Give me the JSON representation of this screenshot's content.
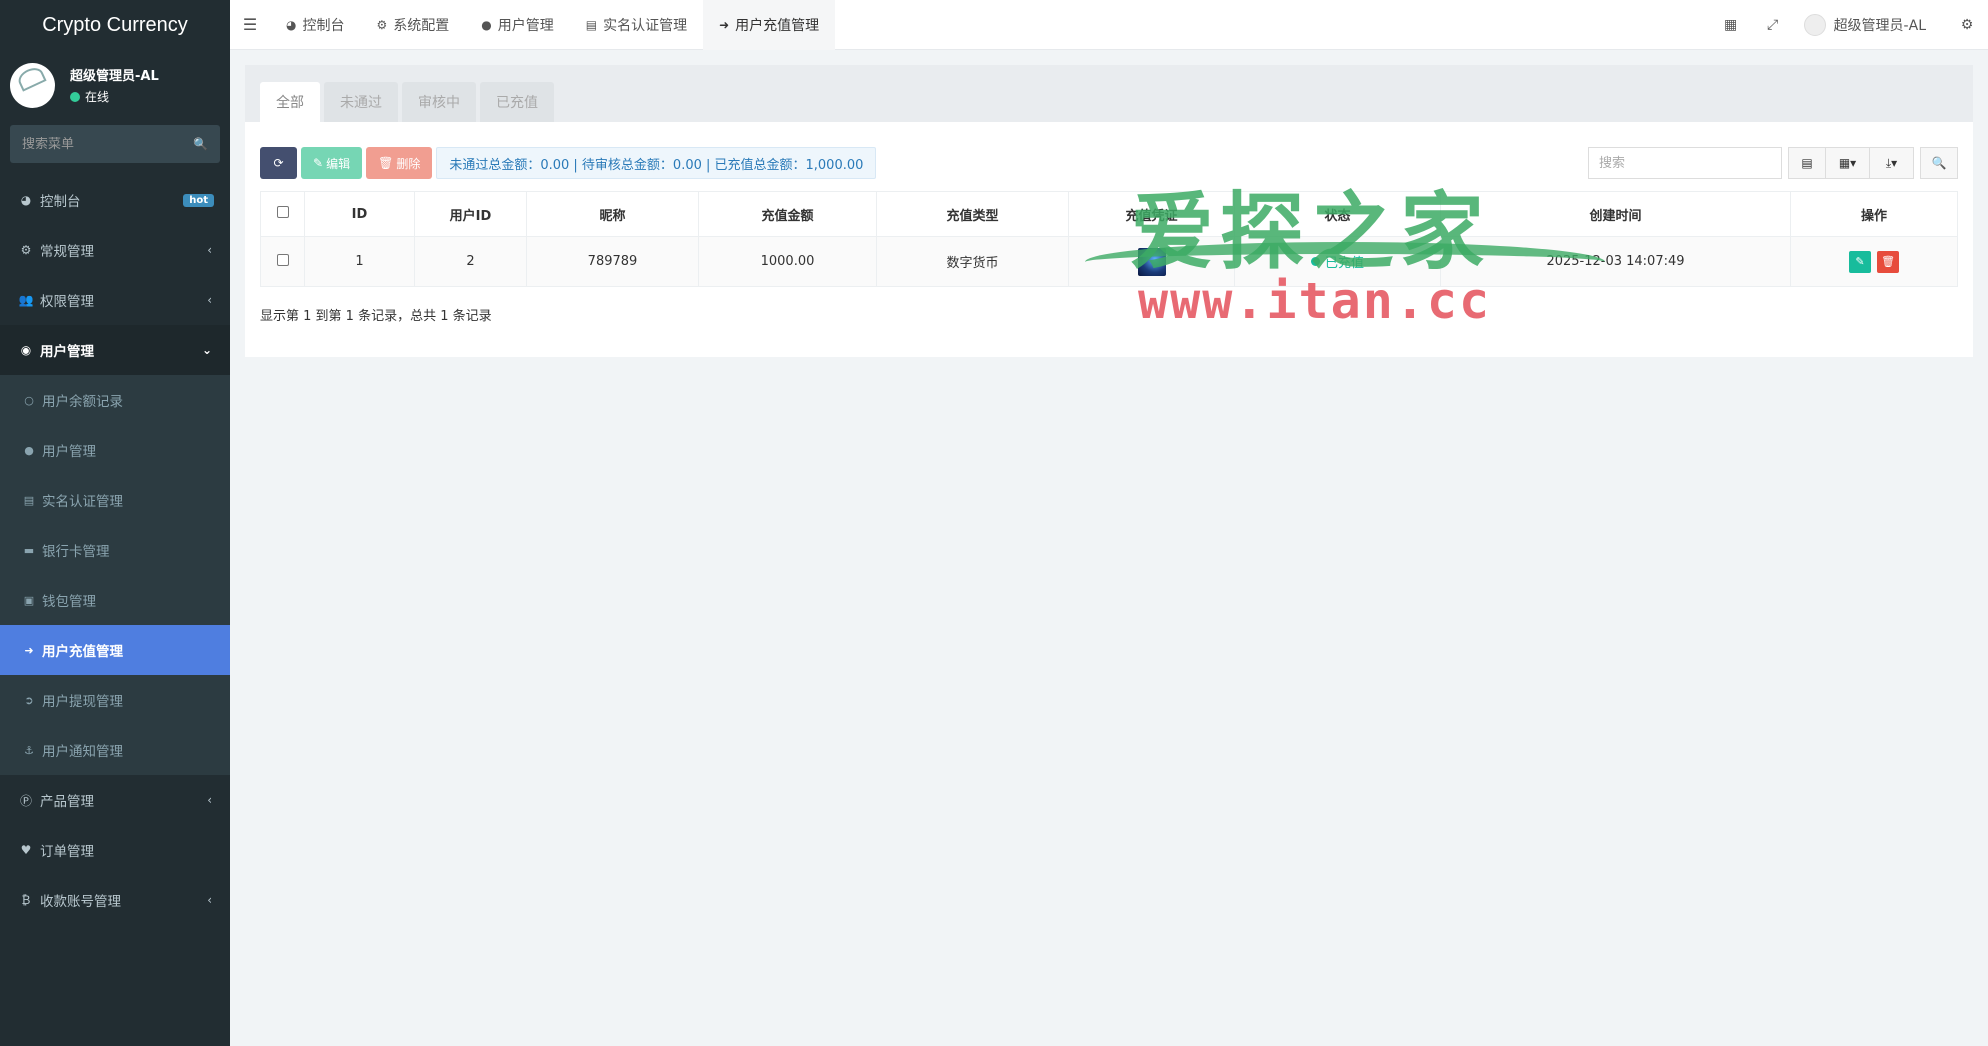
{
  "app": {
    "title": "Crypto Currency"
  },
  "user": {
    "name": "超级管理员-AL",
    "status": "在线"
  },
  "sidebar": {
    "search_placeholder": "搜索菜单",
    "hot_badge": "hot",
    "items": [
      {
        "label": "控制台",
        "icon": "dashboard-icon"
      },
      {
        "label": "常规管理",
        "icon": "cogs-icon"
      },
      {
        "label": "权限管理",
        "icon": "group-icon"
      },
      {
        "label": "用户管理",
        "icon": "user-circle-icon"
      }
    ],
    "sub_items": [
      {
        "label": "用户余额记录",
        "icon": "circle-icon"
      },
      {
        "label": "用户管理",
        "icon": "user-icon"
      },
      {
        "label": "实名认证管理",
        "icon": "id-card-icon"
      },
      {
        "label": "银行卡管理",
        "icon": "credit-card-icon"
      },
      {
        "label": "钱包管理",
        "icon": "money-icon"
      },
      {
        "label": "用户充值管理",
        "icon": "sign-in-icon"
      },
      {
        "label": "用户提现管理",
        "icon": "sign-out-icon"
      },
      {
        "label": "用户通知管理",
        "icon": "anchor-icon"
      }
    ],
    "bottom_items": [
      {
        "label": "产品管理",
        "icon": "product-icon"
      },
      {
        "label": "订单管理",
        "icon": "heartbeat-icon"
      },
      {
        "label": "收款账号管理",
        "icon": "bitcoin-icon"
      }
    ]
  },
  "topbar": {
    "tabs": [
      {
        "label": "控制台"
      },
      {
        "label": "系统配置"
      },
      {
        "label": "用户管理"
      },
      {
        "label": "实名认证管理"
      },
      {
        "label": "用户充值管理"
      }
    ],
    "user_label": "超级管理员-AL"
  },
  "subtabs": [
    "全部",
    "未通过",
    "审核中",
    "已充值"
  ],
  "toolbar": {
    "edit_label": "编辑",
    "delete_label": "删除",
    "totals_text": "未通过总金额：0.00 | 待审核总金额：0.00 | 已充值总金额：1,000.00",
    "search_placeholder": "搜索"
  },
  "table": {
    "headers": [
      "ID",
      "用户ID",
      "昵称",
      "充值金额",
      "充值类型",
      "充值凭证",
      "状态",
      "创建时间",
      "操作"
    ],
    "rows": [
      {
        "id": "1",
        "user_id": "2",
        "nickname": "789789",
        "amount": "1000.00",
        "type": "数字货币",
        "status": "已充值",
        "created": "2025-12-03 14:07:49"
      }
    ]
  },
  "pager": {
    "summary": "显示第 1 到第 1 条记录，总共 1 条记录"
  },
  "watermark": {
    "cn": "爱探之家",
    "en": "www.itan.cc"
  }
}
